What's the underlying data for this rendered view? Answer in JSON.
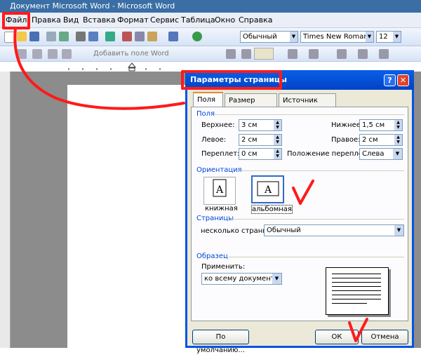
{
  "window": {
    "title": "Документ Microsoft Word - Microsoft Word"
  },
  "menu": [
    "Файл",
    "Правка",
    "Вид",
    "Вставка",
    "Формат",
    "Сервис",
    "Таблица",
    "Окно",
    "Справка"
  ],
  "toolbar": {
    "style_value": "Обычный",
    "font_value": "Times New Roman",
    "size_value": "12",
    "add_field_label": "Добавить поле Word"
  },
  "dialog": {
    "title": "Параметры страницы",
    "help_btn": "?",
    "close_btn": "✕",
    "tabs": [
      "Поля",
      "Размер бумаги",
      "Источник бумаги"
    ],
    "margins_group": "Поля",
    "top_label": "Верхнее:",
    "top_value": "3 см",
    "bottom_label": "Нижнее:",
    "bottom_value": "1,5 см",
    "left_label": "Левое:",
    "left_value": "2 см",
    "right_label": "Правое:",
    "right_value": "2 см",
    "gutter_label": "Переплет:",
    "gutter_value": "0 см",
    "gutter_pos_label": "Положение переплета:",
    "gutter_pos_value": "Слева",
    "orientation_group": "Ориентация",
    "portrait_label": "книжная",
    "landscape_label": "альбомная",
    "pages_group": "Страницы",
    "multiple_pages_label": "несколько страниц:",
    "multiple_pages_value": "Обычный",
    "sample_group": "Образец",
    "apply_label": "Применить:",
    "apply_value": "ко всему документу",
    "default_btn": "По умолчанию...",
    "ok_btn": "ОК",
    "cancel_btn": "Отмена"
  },
  "colors": {
    "annotation": "#ff1a1a",
    "dialog_title": "#0a5ee8"
  }
}
